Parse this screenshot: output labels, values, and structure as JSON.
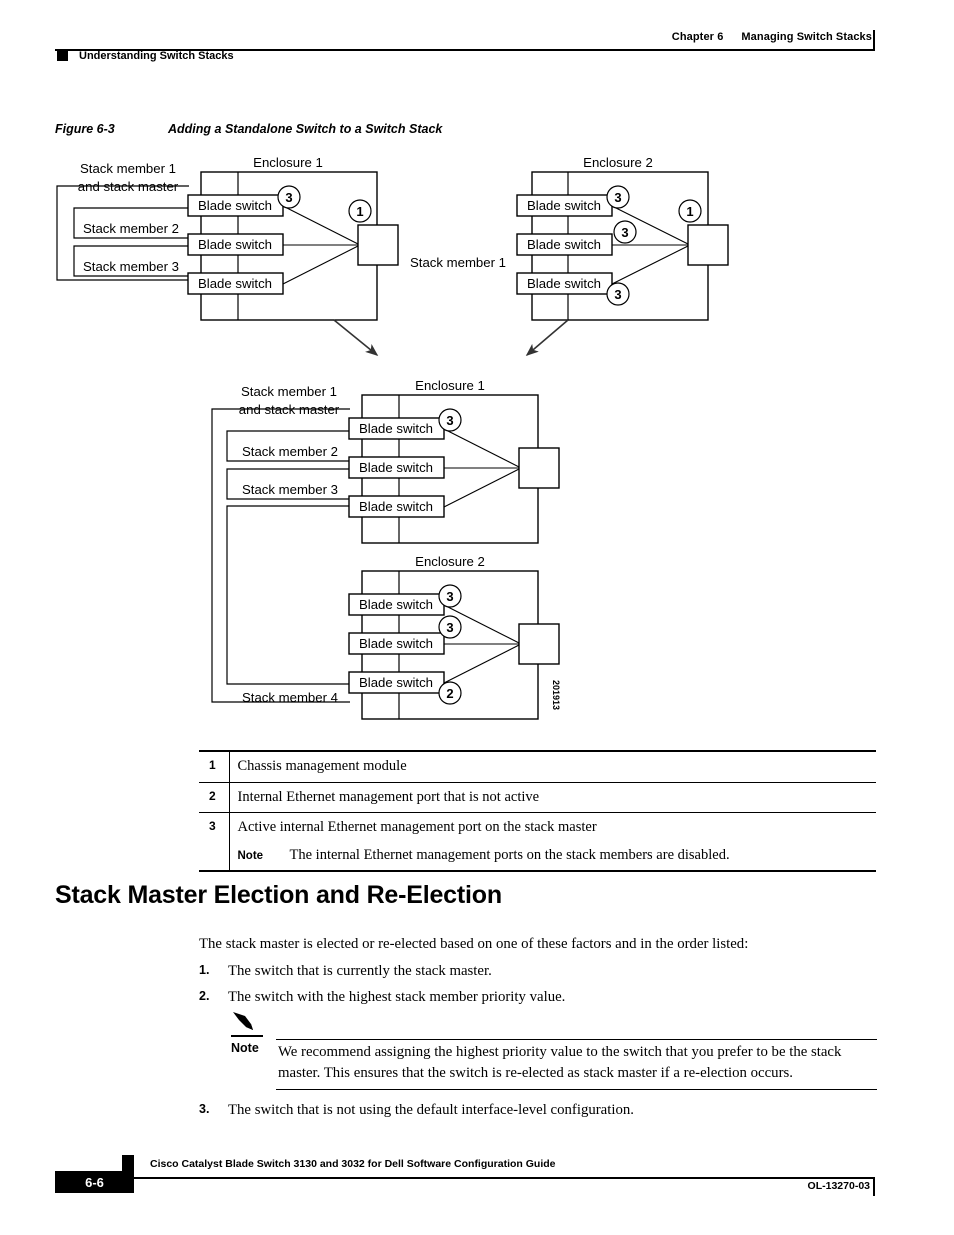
{
  "header": {
    "chapter": "Chapter 6",
    "chapter_title": "Managing Switch Stacks",
    "running_head": "Understanding Switch Stacks"
  },
  "figure": {
    "number": "Figure 6-3",
    "title": "Adding a Standalone Switch to a Switch Stack",
    "artwork_id": "201913",
    "diagrams": {
      "top_left": {
        "enclosure_label": "Enclosure 1",
        "member_labels": [
          "Stack member 1",
          "and stack master",
          "Stack member 2",
          "Stack member 3"
        ],
        "blade_labels": [
          "Blade switch",
          "Blade switch",
          "Blade switch"
        ],
        "callouts": [
          "3",
          "1"
        ]
      },
      "top_right": {
        "enclosure_label": "Enclosure 2",
        "member_label": "Stack member 1",
        "blade_labels": [
          "Blade switch",
          "Blade switch",
          "Blade switch"
        ],
        "callouts": [
          "3",
          "3",
          "3",
          "1"
        ]
      },
      "bottom_enclosure1": {
        "enclosure_label": "Enclosure 1",
        "member_labels": [
          "Stack member 1",
          "and stack master",
          "Stack member 2",
          "Stack member 3"
        ],
        "blade_labels": [
          "Blade switch",
          "Blade switch",
          "Blade switch"
        ],
        "callouts": [
          "3"
        ]
      },
      "bottom_enclosure2": {
        "enclosure_label": "Enclosure 2",
        "member_label": "Stack member 4",
        "blade_labels": [
          "Blade switch",
          "Blade switch",
          "Blade switch"
        ],
        "callouts": [
          "3",
          "3",
          "2"
        ]
      }
    }
  },
  "legend": {
    "rows": [
      {
        "num": "1",
        "text": "Chassis management module"
      },
      {
        "num": "2",
        "text": "Internal Ethernet management port that is not active"
      },
      {
        "num": "3",
        "text": "Active internal Ethernet management port on the stack master",
        "note_label": "Note",
        "note_text": "The internal Ethernet management ports on the stack members are disabled."
      }
    ]
  },
  "section": {
    "heading": "Stack Master Election and Re-Election",
    "intro": "The stack master is elected or re-elected based on one of these factors and in the order listed:",
    "items": [
      {
        "n": "1.",
        "text": "The switch that is currently the stack master."
      },
      {
        "n": "2.",
        "text": "The switch with the highest stack member priority value."
      },
      {
        "n": "3.",
        "text": "The switch that is not using the default interface-level configuration."
      }
    ],
    "note": {
      "label": "Note",
      "text": "We recommend assigning the highest priority value to the switch that you prefer to be the stack master. This ensures that the switch is re-elected as stack master if a re-election occurs."
    }
  },
  "footer": {
    "title": "Cisco Catalyst Blade Switch 3130 and 3032 for Dell Software Configuration Guide",
    "page": "6-6",
    "doc_id": "OL-13270-03"
  }
}
